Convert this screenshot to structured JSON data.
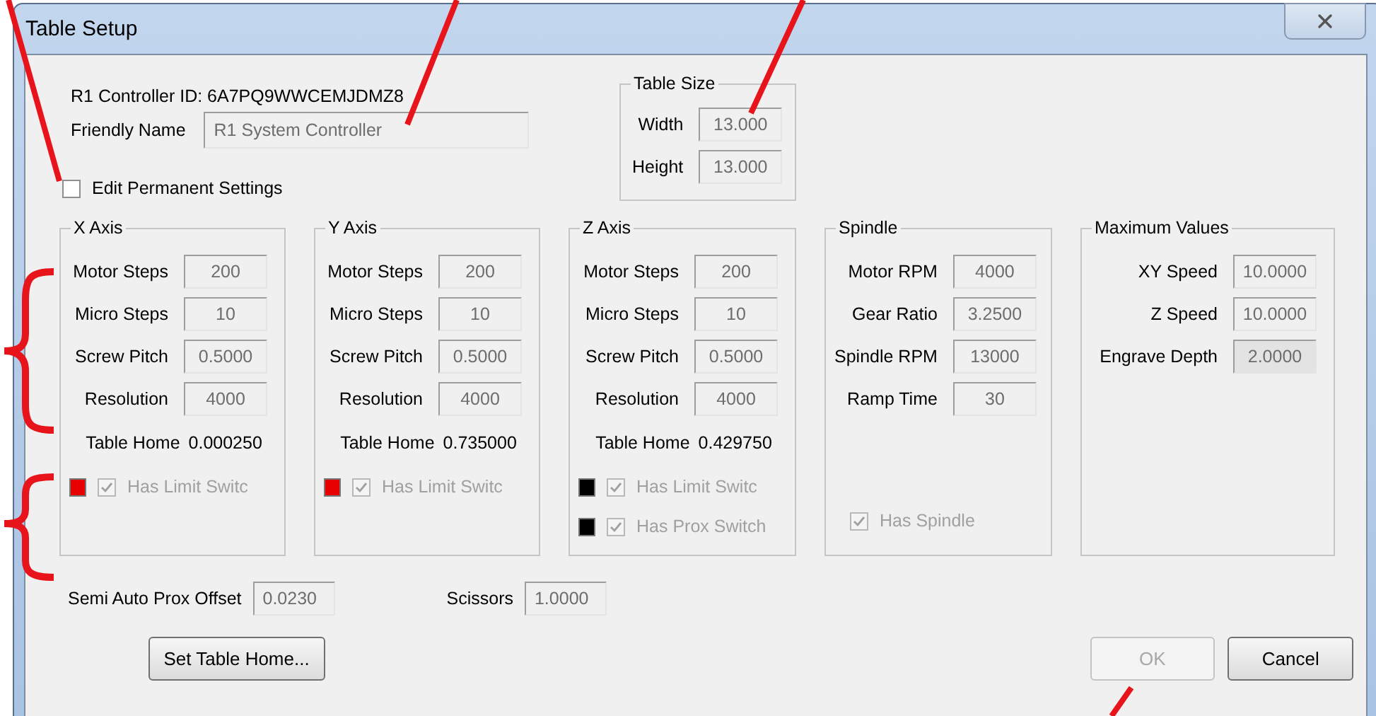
{
  "window": {
    "title": "Table Setup"
  },
  "controller_id": "R1 Controller ID: 6A7PQ9WWCEMJDMZ8",
  "friendly_name": {
    "label": "Friendly Name",
    "value": "R1 System Controller"
  },
  "edit_permanent_settings": {
    "label": "Edit Permanent Settings",
    "checked": false
  },
  "table_size": {
    "title": "Table Size",
    "fields": [
      {
        "label": "Width",
        "value": "13.000"
      },
      {
        "label": "Height",
        "value": "13.000"
      }
    ]
  },
  "groups": [
    {
      "title": "X Axis",
      "fields": [
        {
          "label": "Motor Steps",
          "value": "200"
        },
        {
          "label": "Micro Steps",
          "value": "10"
        },
        {
          "label": "Screw Pitch",
          "value": "0.5000"
        },
        {
          "label": "Resolution",
          "value": "4000"
        }
      ],
      "table_home": {
        "label": "Table Home",
        "value": "0.000250"
      },
      "switches": [
        {
          "label": "Has Limit Switc",
          "checked": true,
          "color": "#e60000"
        }
      ]
    },
    {
      "title": "Y Axis",
      "fields": [
        {
          "label": "Motor Steps",
          "value": "200"
        },
        {
          "label": "Micro Steps",
          "value": "10"
        },
        {
          "label": "Screw Pitch",
          "value": "0.5000"
        },
        {
          "label": "Resolution",
          "value": "4000"
        }
      ],
      "table_home": {
        "label": "Table Home",
        "value": "0.735000"
      },
      "switches": [
        {
          "label": "Has Limit Switc",
          "checked": true,
          "color": "#e60000"
        }
      ]
    },
    {
      "title": "Z Axis",
      "fields": [
        {
          "label": "Motor Steps",
          "value": "200"
        },
        {
          "label": "Micro Steps",
          "value": "10"
        },
        {
          "label": "Screw Pitch",
          "value": "0.5000"
        },
        {
          "label": "Resolution",
          "value": "4000"
        }
      ],
      "table_home": {
        "label": "Table Home",
        "value": "0.429750"
      },
      "switches": [
        {
          "label": "Has Limit Switc",
          "checked": true,
          "color": "#000000"
        },
        {
          "label": "Has Prox Switch",
          "checked": true,
          "color": "#000000"
        }
      ]
    },
    {
      "title": "Spindle",
      "fields": [
        {
          "label": "Motor RPM",
          "value": "4000"
        },
        {
          "label": "Gear Ratio",
          "value": "3.2500"
        },
        {
          "label": "Spindle RPM",
          "value": "13000"
        },
        {
          "label": "Ramp Time",
          "value": "30"
        }
      ],
      "switches": [
        {
          "label": "Has Spindle",
          "checked": true
        }
      ]
    },
    {
      "title": "Maximum Values",
      "fields": [
        {
          "label": "XY Speed",
          "value": "10.0000",
          "disabled": false
        },
        {
          "label": "Z Speed",
          "value": "10.0000",
          "disabled": false
        },
        {
          "label": "Engrave Depth",
          "value": "2.0000",
          "disabled": true
        }
      ]
    }
  ],
  "semi_auto_prox_offset": {
    "label": "Semi Auto Prox Offset",
    "value": "0.0230"
  },
  "scissors": {
    "label": "Scissors",
    "value": "1.0000"
  },
  "buttons": [
    {
      "label": "Set Table Home...",
      "disabled": false
    },
    {
      "label": "OK",
      "disabled": true
    },
    {
      "label": "Cancel",
      "disabled": false
    }
  ]
}
